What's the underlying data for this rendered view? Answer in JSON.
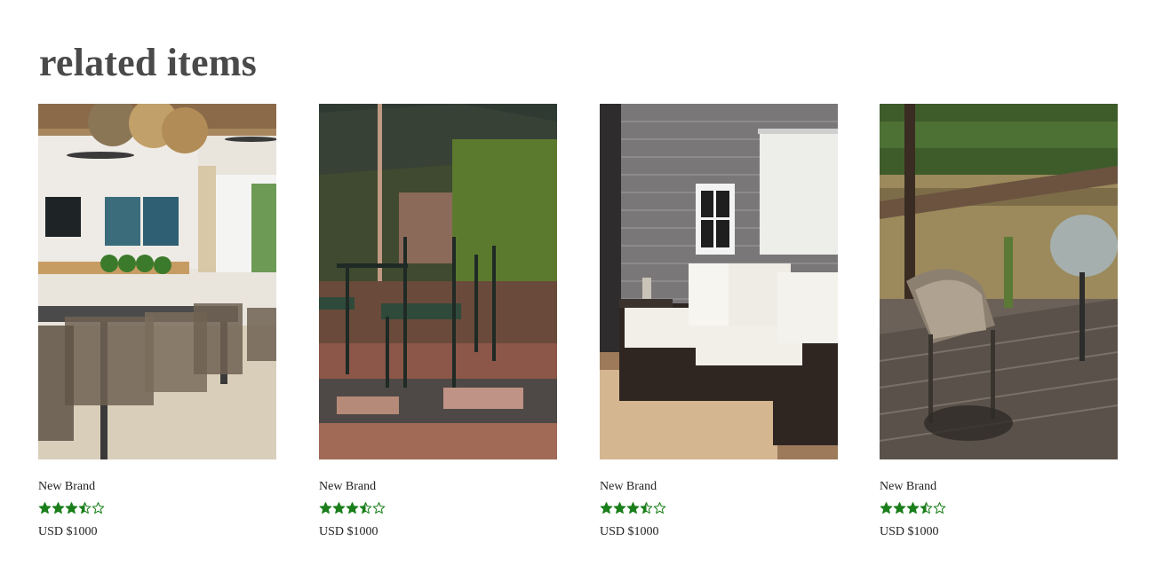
{
  "section": {
    "title": "related items"
  },
  "colors": {
    "title": "#4a4a4a",
    "star": "#1a7f1a"
  },
  "products": [
    {
      "image": "covered patio with wicker chairs and long table",
      "brand": "New Brand",
      "rating": 3.5,
      "rating_max": 5,
      "price": "USD $1000"
    },
    {
      "image": "metal bistro chairs under umbrella in garden",
      "brand": "New Brand",
      "rating": 3.5,
      "rating_max": 5,
      "price": "USD $1000"
    },
    {
      "image": "white cushioned wicker sofa beside grey house",
      "brand": "New Brand",
      "rating": 3.5,
      "rating_max": 5,
      "price": "USD $1000"
    },
    {
      "image": "wicker chair on deck overlooking vineyard",
      "brand": "New Brand",
      "rating": 3.5,
      "rating_max": 5,
      "price": "USD $1000"
    }
  ]
}
